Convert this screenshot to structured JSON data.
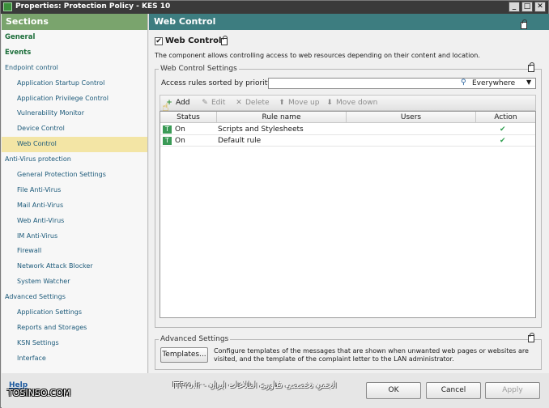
{
  "window": {
    "title": "Properties: Protection Policy - KES 10",
    "controls": [
      "_",
      "□",
      "✕"
    ]
  },
  "sidebar": {
    "header": "Sections",
    "items": [
      {
        "label": "General",
        "style": "bold"
      },
      {
        "label": "Events",
        "style": "bold"
      },
      {
        "label": "Endpoint control",
        "style": "group"
      },
      {
        "label": "Application Startup Control",
        "style": "sub"
      },
      {
        "label": "Application Privilege Control",
        "style": "sub"
      },
      {
        "label": "Vulnerability Monitor",
        "style": "sub"
      },
      {
        "label": "Device Control",
        "style": "sub"
      },
      {
        "label": "Web Control",
        "style": "sub",
        "selected": true
      },
      {
        "label": "Anti-Virus protection",
        "style": "group"
      },
      {
        "label": "General Protection Settings",
        "style": "sub"
      },
      {
        "label": "File Anti-Virus",
        "style": "sub"
      },
      {
        "label": "Mail Anti-Virus",
        "style": "sub"
      },
      {
        "label": "Web Anti-Virus",
        "style": "sub"
      },
      {
        "label": "IM Anti-Virus",
        "style": "sub"
      },
      {
        "label": "Firewall",
        "style": "sub"
      },
      {
        "label": "Network Attack Blocker",
        "style": "sub"
      },
      {
        "label": "System Watcher",
        "style": "sub"
      },
      {
        "label": "Advanced Settings",
        "style": "group"
      },
      {
        "label": "Application Settings",
        "style": "sub"
      },
      {
        "label": "Reports and Storages",
        "style": "sub"
      },
      {
        "label": "KSN Settings",
        "style": "sub"
      },
      {
        "label": "Interface",
        "style": "sub"
      }
    ]
  },
  "main": {
    "header": "Web Control",
    "enable_label": "Web Control",
    "enable_checked": "✔",
    "description": "The component allows controlling access to web resources depending on their content and location.",
    "settings_group_title": "Web Control Settings",
    "sort_label": "Access rules sorted by priority:",
    "search_value": "",
    "search_scope": "Everywhere",
    "toolbar": {
      "add": "Add",
      "edit": "Edit",
      "delete": "Delete",
      "move_up": "Move up",
      "move_down": "Move down"
    },
    "grid": {
      "columns": [
        "Status",
        "Rule name",
        "Users",
        "Action"
      ],
      "rows": [
        {
          "status": "On",
          "rule_name": "Scripts and Stylesheets",
          "users": "",
          "action": "✔"
        },
        {
          "status": "On",
          "rule_name": "Default rule",
          "users": "",
          "action": "✔"
        }
      ]
    },
    "advanced_group_title": "Advanced Settings",
    "templates_button": "Templates...",
    "templates_description": "Configure templates of the messages that are shown when unwanted web pages or websites are visited, and the template of the complaint letter to the LAN administrator."
  },
  "footer": {
    "help": "Help",
    "watermark_left": "TOSINSO.COM",
    "watermark_right": "ITPro.ir - انجمن تخصصی فناوری اطلاعات ایران",
    "ok": "OK",
    "cancel": "Cancel",
    "apply": "Apply"
  },
  "colors": {
    "sidebar_header": "#7aa46d",
    "main_header": "#3d7d80",
    "selected_item": "#f3e5a5",
    "status_on": "#3a9a56"
  }
}
